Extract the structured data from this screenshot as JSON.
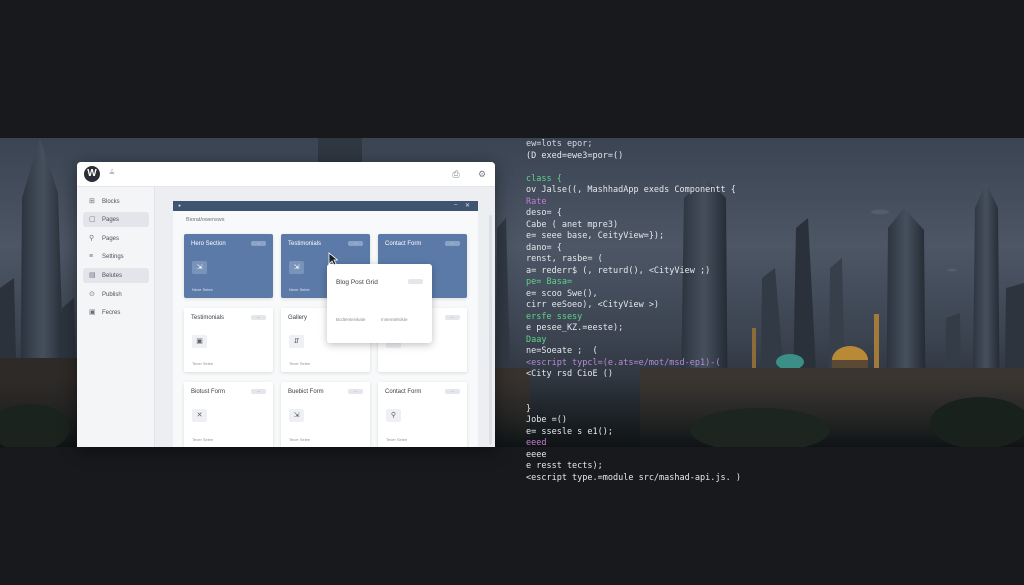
{
  "wordpress": {
    "top_text": "≟",
    "sidebar": [
      {
        "label": "Blocks",
        "icon": "⊞"
      },
      {
        "label": "Pages",
        "icon": "▢"
      },
      {
        "label": "Pages",
        "icon": "⚲"
      },
      {
        "label": "Settings",
        "icon": "≡"
      },
      {
        "label": "Belutes",
        "icon": "▤"
      },
      {
        "label": "Publish",
        "icon": "⊙"
      },
      {
        "label": "Fecres",
        "icon": "▣"
      }
    ],
    "panel_subtitle": "Biorat/owensws",
    "tiles": [
      {
        "title": "Hero Section",
        "badge": "—",
        "icon": "⇲",
        "foot": "Nexe Seiee"
      },
      {
        "title": "Testimonials",
        "badge": "—",
        "icon": "⇲",
        "foot": "Nexe Seiee"
      },
      {
        "title": "Contact Form",
        "badge": "—",
        "icon": "",
        "foot": ""
      },
      {
        "title": "Testimonials",
        "badge": "—",
        "icon": "▣",
        "foot": "Tecer Seiee"
      },
      {
        "title": "Gallery",
        "badge": "",
        "icon": "⇵",
        "foot": "Tecer Seiee"
      },
      {
        "title": "",
        "badge": "—",
        "icon": "↩",
        "foot": ""
      },
      {
        "title": "Biotust Form",
        "badge": "—",
        "icon": "✕",
        "foot": "Tecer Seiee"
      },
      {
        "title": "Buebict Form",
        "badge": "—",
        "icon": "⇲",
        "foot": "Tecer Seiee"
      },
      {
        "title": "Contact Form",
        "badge": "—",
        "icon": "⚲",
        "foot": "Tecer Seiee"
      }
    ],
    "popover": {
      "title": "Blog Post Grid",
      "text_a": "Bcdtenteivkate",
      "text_b": "Irvtemtelsikte"
    }
  },
  "code_lines": [
    {
      "text": "ew=lots epor;",
      "color": "#d6d9de"
    },
    {
      "text": "(D exed=ewe3=por=()",
      "color": "#e6e8ec"
    },
    {
      "text": "",
      "color": "#e6e8ec"
    },
    {
      "text": "class {",
      "color": "#5fd38a"
    },
    {
      "text": "ov Jalse((, MashhadApp exeds Componentt {",
      "color": "#e6e8ec"
    },
    {
      "text": "Rate",
      "color": "#c57bd6"
    },
    {
      "text": "deso= {",
      "color": "#e6e8ec"
    },
    {
      "text": "Cabe ( anet mpre3)",
      "color": "#e6e8ec"
    },
    {
      "text": "e= seee base, CeityView=});",
      "color": "#e6e8ec"
    },
    {
      "text": "dano= {",
      "color": "#e6e8ec"
    },
    {
      "text": "renst, rasbe= (",
      "color": "#e6e8ec"
    },
    {
      "text": "a= rederr$ (, returd(), <CityView ;)",
      "color": "#e6e8ec"
    },
    {
      "text": "pe= Basa=",
      "color": "#5fd38a"
    },
    {
      "text": "e= scoo Swe(),",
      "color": "#e6e8ec"
    },
    {
      "text": "cirr eeSoeo), <CityView >)",
      "color": "#e6e8ec"
    },
    {
      "text": "ersfe ssesy",
      "color": "#5fd38a"
    },
    {
      "text": "e pesee_KZ.=eeste);",
      "color": "#e6e8ec"
    },
    {
      "text": "Daay",
      "color": "#5fd38a"
    },
    {
      "text": "ne=Soeate ;  (",
      "color": "#e6e8ec"
    },
    {
      "text": "<escript typcl=(e.ats=e/mot/msd-ep1)-(",
      "color": "#b38bd9"
    },
    {
      "text": "<City rsd CioE ()",
      "color": "#e6e8ec"
    },
    {
      "text": "",
      "color": "#e6e8ec"
    },
    {
      "text": "",
      "color": "#e6e8ec"
    },
    {
      "text": "}",
      "color": "#e6e8ec"
    },
    {
      "text": "Jobe =()",
      "color": "#e6e8ec"
    },
    {
      "text": "e= ssesle s e1();",
      "color": "#e6e8ec"
    },
    {
      "text": "eeed",
      "color": "#c57bd6"
    },
    {
      "text": "eeee",
      "color": "#e6e8ec"
    },
    {
      "text": "e resst tects);",
      "color": "#e6e8ec"
    },
    {
      "text": "<escript type.=module src/mashad-api.js. )",
      "color": "#e6e8ec"
    }
  ]
}
